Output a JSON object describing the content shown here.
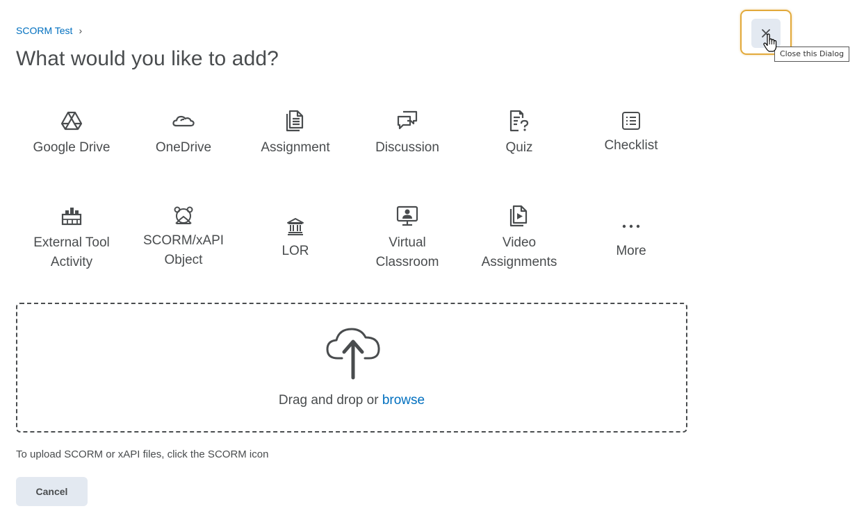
{
  "breadcrumb": {
    "link": "SCORM Test",
    "separator": "›"
  },
  "title": "What would you like to add?",
  "close": {
    "tooltip": "Close this Dialog",
    "icon": "close-icon"
  },
  "tiles": {
    "google_drive": {
      "label": "Google Drive",
      "icon": "google-drive-icon"
    },
    "onedrive": {
      "label": "OneDrive",
      "icon": "onedrive-icon"
    },
    "assignment": {
      "label": "Assignment",
      "icon": "assignment-icon"
    },
    "discussion": {
      "label": "Discussion",
      "icon": "discussion-icon"
    },
    "quiz": {
      "label": "Quiz",
      "icon": "quiz-icon"
    },
    "checklist": {
      "label": "Checklist",
      "icon": "checklist-icon"
    },
    "external_tool": {
      "line1": "External Tool",
      "line2": "Activity",
      "icon": "external-tool-icon"
    },
    "scorm": {
      "line1": "SCORM/xAPI",
      "line2": "Object",
      "icon": "scorm-icon"
    },
    "lor": {
      "label": "LOR",
      "icon": "lor-icon"
    },
    "virtual_classroom": {
      "line1": "Virtual",
      "line2": "Classroom",
      "icon": "virtual-classroom-icon"
    },
    "video_assignments": {
      "line1": "Video",
      "line2": "Assignments",
      "icon": "video-assignment-icon"
    },
    "more": {
      "label": "More",
      "icon": "more-icon"
    }
  },
  "dropzone": {
    "text": "Drag and drop or ",
    "browse": "browse",
    "icon": "upload-cloud-icon"
  },
  "hint": "To upload SCORM or xAPI files, click the SCORM icon",
  "cancel": "Cancel",
  "colors": {
    "accent": "#006fbf",
    "focus_ring": "#e2a93a",
    "button_bg": "#e3e9f1",
    "text": "#494c4e"
  }
}
